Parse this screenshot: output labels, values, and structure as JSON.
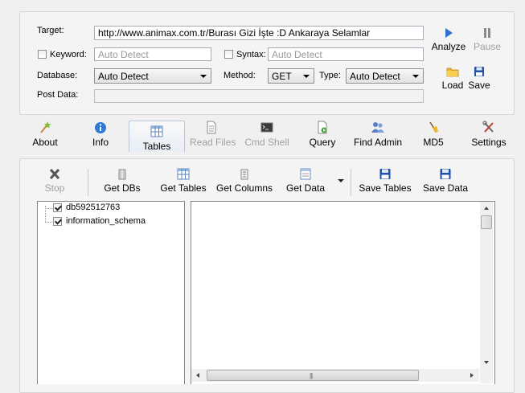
{
  "form": {
    "target_label": "Target:",
    "target_value": "http://www.animax.com.tr/Burası Gizi İşte :D Ankaraya Selamlar",
    "keyword_label": "Keyword:",
    "keyword_placeholder": "Auto Detect",
    "syntax_label": "Syntax:",
    "syntax_placeholder": "Auto Detect",
    "database_label": "Database:",
    "database_value": "Auto Detect",
    "method_label": "Method:",
    "method_value": "GET",
    "type_label": "Type:",
    "type_value": "Auto Detect",
    "postdata_label": "Post Data:",
    "postdata_value": ""
  },
  "actions": {
    "analyze": "Analyze",
    "pause": "Pause",
    "load": "Load",
    "save": "Save"
  },
  "tabs": [
    {
      "label": "About",
      "icon": "wand-icon",
      "enabled": true
    },
    {
      "label": "Info",
      "icon": "info-icon",
      "enabled": true
    },
    {
      "label": "Tables",
      "icon": "table-icon",
      "enabled": true,
      "selected": true
    },
    {
      "label": "Read Files",
      "icon": "document-icon",
      "enabled": false
    },
    {
      "label": "Cmd Shell",
      "icon": "terminal-icon",
      "enabled": false
    },
    {
      "label": "Query",
      "icon": "query-icon",
      "enabled": true
    },
    {
      "label": "Find Admin",
      "icon": "users-icon",
      "enabled": true
    },
    {
      "label": "MD5",
      "icon": "broom-icon",
      "enabled": true
    },
    {
      "label": "Settings",
      "icon": "tools-icon",
      "enabled": true
    }
  ],
  "toolbar": {
    "stop": "Stop",
    "get_dbs": "Get DBs",
    "get_tables": "Get Tables",
    "get_columns": "Get Columns",
    "get_data": "Get Data",
    "save_tables": "Save Tables",
    "save_data": "Save Data"
  },
  "tree": {
    "items": [
      {
        "label": "db592512763",
        "checked": true
      },
      {
        "label": "information_schema",
        "checked": true
      }
    ]
  },
  "colors": {
    "play_blue": "#2f6fd0",
    "save_blue": "#1f4fa8",
    "info_blue": "#2b7ad6"
  }
}
